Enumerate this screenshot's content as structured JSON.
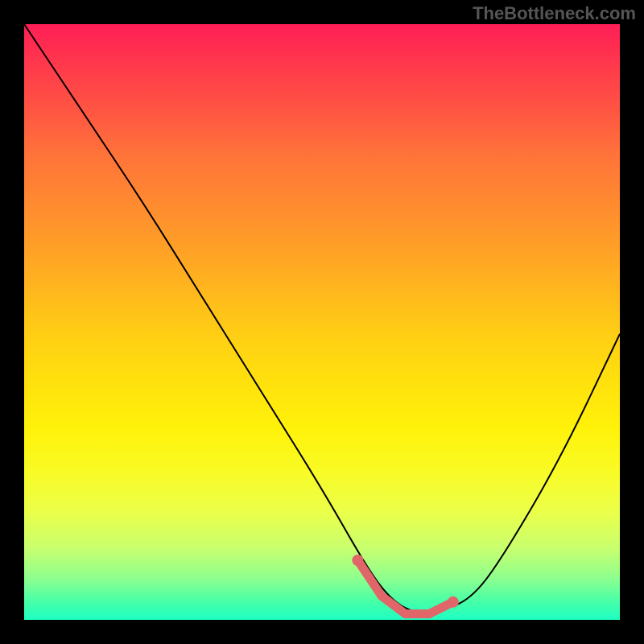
{
  "attribution": "TheBottleneck.com",
  "chart_data": {
    "type": "line",
    "title": "",
    "xlabel": "",
    "ylabel": "",
    "xlim": [
      0,
      100
    ],
    "ylim": [
      0,
      100
    ],
    "grid": false,
    "series": [
      {
        "name": "bottleneck-curve",
        "x": [
          0,
          10,
          20,
          30,
          40,
          50,
          58,
          62,
          66,
          70,
          75,
          80,
          90,
          100
        ],
        "values": [
          100,
          85,
          70,
          54,
          38,
          22,
          8,
          3,
          1,
          1.5,
          3.5,
          10,
          27,
          48
        ]
      }
    ],
    "markers": {
      "name": "highlighted-range",
      "x": [
        56,
        60,
        64,
        68,
        72
      ],
      "values": [
        10,
        4,
        1,
        1,
        3
      ]
    },
    "colors": {
      "curve": "#000000",
      "marker": "#e06669",
      "gradient_top": "#ff1e56",
      "gradient_bottom": "#1effc2"
    }
  }
}
